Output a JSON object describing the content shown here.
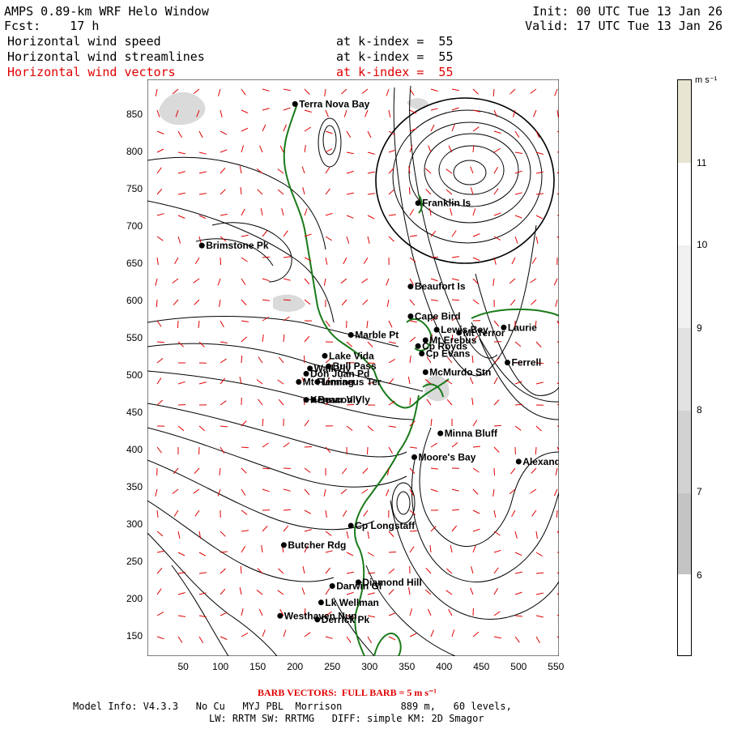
{
  "header": {
    "title": "AMPS 0.89-km WRF Helo Window",
    "forecast": "Fcst:    17 h",
    "init": "Init: 00 UTC Tue 13 Jan 26",
    "valid": "Valid: 17 UTC Tue 13 Jan 26",
    "fields": [
      {
        "label": "Horizontal wind speed",
        "level": "at k-index =  55"
      },
      {
        "label": "Horizontal wind streamlines",
        "level": "at k-index =  55"
      },
      {
        "label": "Horizontal wind vectors",
        "level": "at k-index =  55"
      }
    ]
  },
  "axes": {
    "x_ticks": [
      "50",
      "100",
      "150",
      "200",
      "250",
      "300",
      "350",
      "400",
      "450",
      "500",
      "550"
    ],
    "y_ticks": [
      "850",
      "800",
      "750",
      "700",
      "650",
      "600",
      "550",
      "500",
      "450",
      "400",
      "350",
      "300",
      "250",
      "200",
      "150"
    ]
  },
  "colorbar": {
    "unit": "m s⁻¹",
    "ticks": [
      "11",
      "10",
      "9",
      "8",
      "7",
      "6"
    ],
    "colors": [
      "#ffffff",
      "#f0f0f0",
      "#e2e2e2",
      "#d2d2d2",
      "#c4c4c4",
      "#e6e6d2"
    ]
  },
  "colors": {
    "coastline": "#1a7a1a",
    "vectors": "#e00000",
    "streamlines": "#000000",
    "speed_shading": "#d4d4d4"
  },
  "sites": [
    {
      "name": "Terra Nova Bay",
      "x": 200,
      "y": 865
    },
    {
      "name": "Franklin Is",
      "x": 365,
      "y": 732
    },
    {
      "name": "Brimstone Pk",
      "x": 75,
      "y": 675
    },
    {
      "name": "Beaufort Is",
      "x": 355,
      "y": 620
    },
    {
      "name": "Cape Bird",
      "x": 355,
      "y": 580
    },
    {
      "name": "Lewis Bay",
      "x": 390,
      "y": 562
    },
    {
      "name": "Laurie",
      "x": 480,
      "y": 565
    },
    {
      "name": "Mt Terror",
      "x": 420,
      "y": 558
    },
    {
      "name": "Marble Pt",
      "x": 275,
      "y": 555
    },
    {
      "name": "Cp Royds",
      "x": 365,
      "y": 540
    },
    {
      "name": "Mt Erebus",
      "x": 375,
      "y": 548
    },
    {
      "name": "Cp Evans",
      "x": 370,
      "y": 530
    },
    {
      "name": "Lake Vida",
      "x": 240,
      "y": 527
    },
    {
      "name": "Ferrell",
      "x": 485,
      "y": 518
    },
    {
      "name": "Wall Vly",
      "x": 220,
      "y": 510
    },
    {
      "name": "Bull Pass",
      "x": 245,
      "y": 513
    },
    {
      "name": "McMurdo Stn",
      "x": 375,
      "y": 505
    },
    {
      "name": "Don Juan Pd",
      "x": 215,
      "y": 503
    },
    {
      "name": "Mt Fleming",
      "x": 205,
      "y": 492
    },
    {
      "name": "Linnaeus Ter",
      "x": 230,
      "y": 492
    },
    {
      "name": "Kennar Vly",
      "x": 215,
      "y": 468
    },
    {
      "name": "Beacon Vly",
      "x": 225,
      "y": 468
    },
    {
      "name": "Minna Bluff",
      "x": 395,
      "y": 423
    },
    {
      "name": "Moore's Bay",
      "x": 360,
      "y": 391
    },
    {
      "name": "Alexander",
      "x": 500,
      "y": 385
    },
    {
      "name": "Cp Longstaff",
      "x": 275,
      "y": 299
    },
    {
      "name": "Butcher Rdg",
      "x": 185,
      "y": 273
    },
    {
      "name": "Darwin Gl",
      "x": 250,
      "y": 218
    },
    {
      "name": "Diamond Hill",
      "x": 285,
      "y": 223
    },
    {
      "name": "Lk Wellman",
      "x": 235,
      "y": 196
    },
    {
      "name": "Westhaven Nun",
      "x": 180,
      "y": 178
    },
    {
      "name": "Derrick Pk",
      "x": 230,
      "y": 173
    }
  ],
  "footer": {
    "barb_note": "BARB VECTORS:  FULL BARB = 5 m s⁻¹",
    "line1": "Model Info: V4.3.3   No Cu   MYJ PBL  Morrison          889 m,   60 levels,",
    "line2": "LW: RRTM SW: RRTMG   DIFF: simple KM: 2D Smagor"
  }
}
